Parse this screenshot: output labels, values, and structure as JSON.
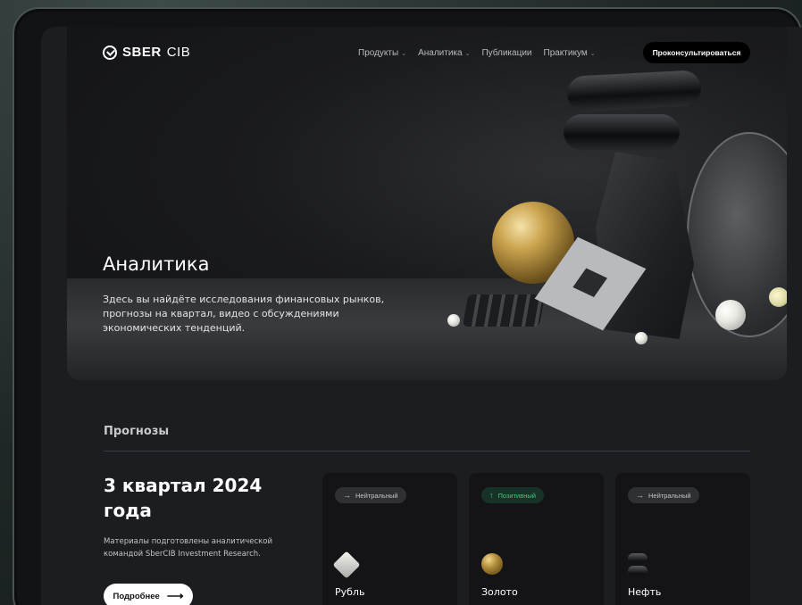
{
  "header": {
    "logo_sber": "SBER",
    "logo_cib": "CIB",
    "menu": [
      {
        "label": "Продукты",
        "has_dropdown": true
      },
      {
        "label": "Аналитика",
        "has_dropdown": true
      },
      {
        "label": "Публикации",
        "has_dropdown": false
      },
      {
        "label": "Практикум",
        "has_dropdown": true
      }
    ],
    "cta_label": "Проконсультироваться"
  },
  "hero": {
    "title": "Аналитика",
    "description": "Здесь вы найдёте исследования финансовых рынков, прогнозы на квартал, видео с обсуждениями экономических тенденций."
  },
  "forecasts": {
    "section_title": "Прогнозы",
    "quarter_title": "3 квартал 2024 года",
    "quarter_desc": "Материалы подготовлены аналитической командой SberCIB Investment Research.",
    "more_label": "Подробнее",
    "cards": [
      {
        "badge": "Нейтральный",
        "badge_icon": "arrow-right-icon",
        "label": "Рубль",
        "icon": "ruble-diamond-icon"
      },
      {
        "badge": "Позитивный",
        "badge_icon": "arrow-up-icon",
        "label": "Золото",
        "icon": "gold-sphere-icon"
      },
      {
        "badge": "Нейтральный",
        "badge_icon": "arrow-right-icon",
        "label": "Нефть",
        "icon": "oil-barrel-icon"
      }
    ]
  },
  "colors": {
    "positive": "#3fca7c",
    "neutral_badge_bg": "#2f3034",
    "page_bg": "#1c1d21",
    "card_bg": "#141417",
    "cta_bg": "#000000"
  }
}
